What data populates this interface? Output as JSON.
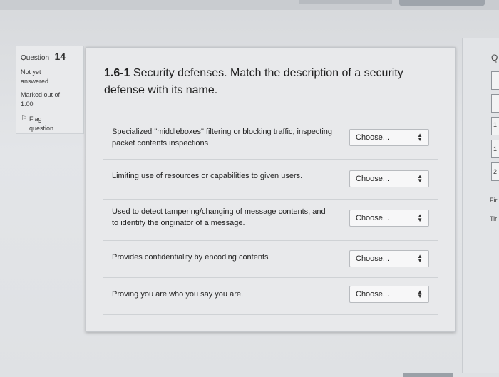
{
  "info": {
    "question_label": "Question",
    "question_number": "14",
    "status_line1": "Not yet",
    "status_line2": "answered",
    "marked_line1": "Marked out of",
    "marked_line2": "1.00",
    "flag_line1": "Flag",
    "flag_line2": "question"
  },
  "question": {
    "number": "1.6-1",
    "text": "Security defenses. Match the description of a security defense with its name."
  },
  "rows": [
    {
      "prompt": "Specialized \"middleboxes\" filtering or blocking traffic, inspecting packet contents inspections",
      "selected": "Choose..."
    },
    {
      "prompt": "Limiting use of resources or capabilities to given users.",
      "selected": "Choose..."
    },
    {
      "prompt": "Used to detect tampering/changing of message contents, and to identify the originator of a message.",
      "selected": "Choose..."
    },
    {
      "prompt": "Provides confidentiality by encoding contents",
      "selected": "Choose..."
    },
    {
      "prompt": "Proving you are who you say you are.",
      "selected": "Choose..."
    }
  ],
  "right_panel": {
    "initial": "Q",
    "nums": [
      "1",
      "1",
      "2"
    ],
    "text1": "Fir",
    "text2": "Tir"
  },
  "icons": {
    "flag": "flag-icon",
    "select_arrows": "updown-arrows-icon"
  }
}
